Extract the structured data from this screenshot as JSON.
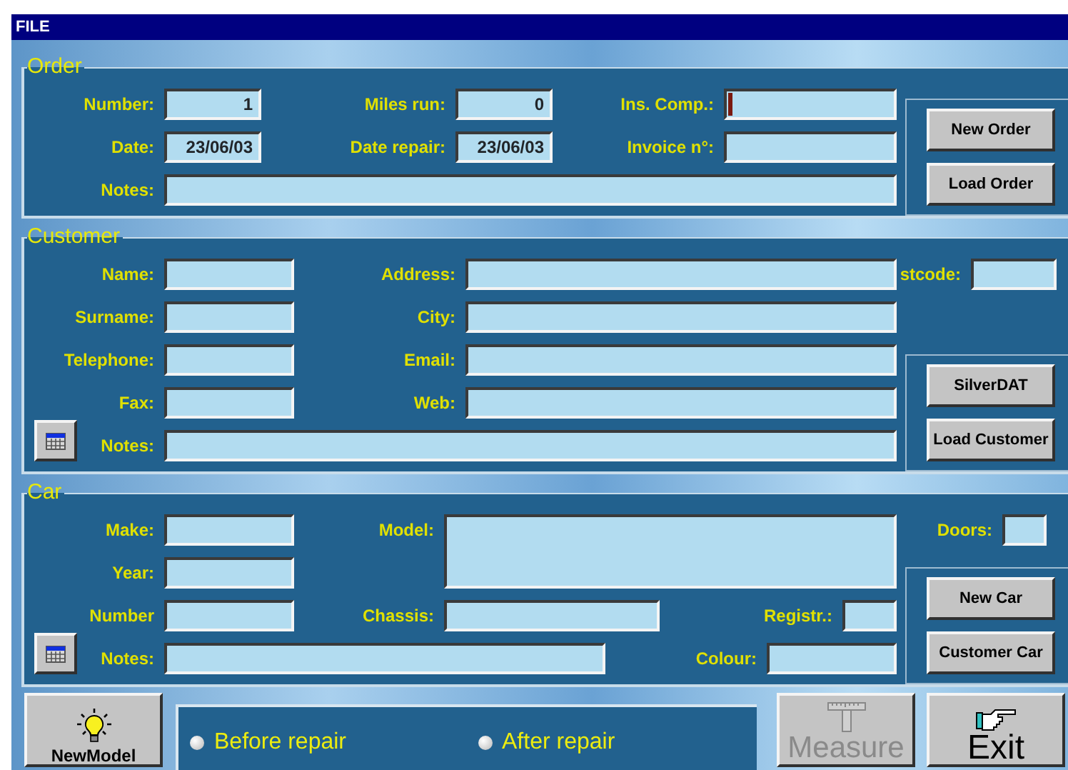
{
  "window": {
    "title": "FILE"
  },
  "sections": [
    {
      "kind": "order",
      "title": "Order",
      "calendar": false,
      "fields": [
        {
          "label": "Number:",
          "value": "1",
          "focused": false
        },
        {
          "label": "Miles run:",
          "value": "0",
          "focused": false
        },
        {
          "label": "Ins. Comp.:",
          "focused": true
        },
        {
          "label": "Date:",
          "value": "23/06/03",
          "focused": false
        },
        {
          "label": "Date repair:",
          "value": "23/06/03",
          "focused": false
        },
        {
          "label": "Invoice n°:",
          "focused": false
        },
        {
          "label": "Notes:",
          "focused": false
        }
      ],
      "buttons": [
        {
          "label": "New Order"
        },
        {
          "label": "Load Order"
        }
      ]
    },
    {
      "kind": "customer",
      "title": "Customer",
      "calendar": true,
      "fields": [
        {
          "label": "Name:",
          "focused": false
        },
        {
          "label": "Address:",
          "focused": false
        },
        {
          "label": "stcode:",
          "focused": false
        },
        {
          "label": "Surname:",
          "focused": false
        },
        {
          "label": "City:",
          "focused": false
        },
        {
          "label": "Telephone:",
          "focused": false
        },
        {
          "label": "Email:",
          "focused": false
        },
        {
          "label": "Fax:",
          "focused": false
        },
        {
          "label": "Web:",
          "focused": false
        },
        {
          "label": "Notes:",
          "focused": false
        }
      ],
      "buttons": [
        {
          "label": "SilverDAT"
        },
        {
          "label": "Load Customer"
        }
      ]
    },
    {
      "kind": "car",
      "title": "Car",
      "calendar": true,
      "fields": [
        {
          "label": "Make:",
          "focused": false
        },
        {
          "label": "Model:",
          "focused": false
        },
        {
          "label": "Doors:",
          "focused": false
        },
        {
          "label": "Year:",
          "focused": false
        },
        {
          "label": "Number",
          "focused": false
        },
        {
          "label": "Chassis:",
          "focused": false
        },
        {
          "label": "Registr.:",
          "focused": false
        },
        {
          "label": "Notes:",
          "focused": false
        },
        {
          "label": "Colour:",
          "focused": false
        }
      ],
      "buttons": [
        {
          "label": "New Car"
        },
        {
          "label": "Customer Car"
        }
      ]
    }
  ],
  "bottom": {
    "new_model": {
      "label": "NewModel"
    },
    "radios": [
      {
        "label": "Before repair",
        "selected": false
      },
      {
        "label": "After repair",
        "selected": false
      }
    ],
    "measure": {
      "label": "Measure",
      "disabled": true
    },
    "exit": {
      "label": "Exit",
      "disabled": false
    }
  }
}
